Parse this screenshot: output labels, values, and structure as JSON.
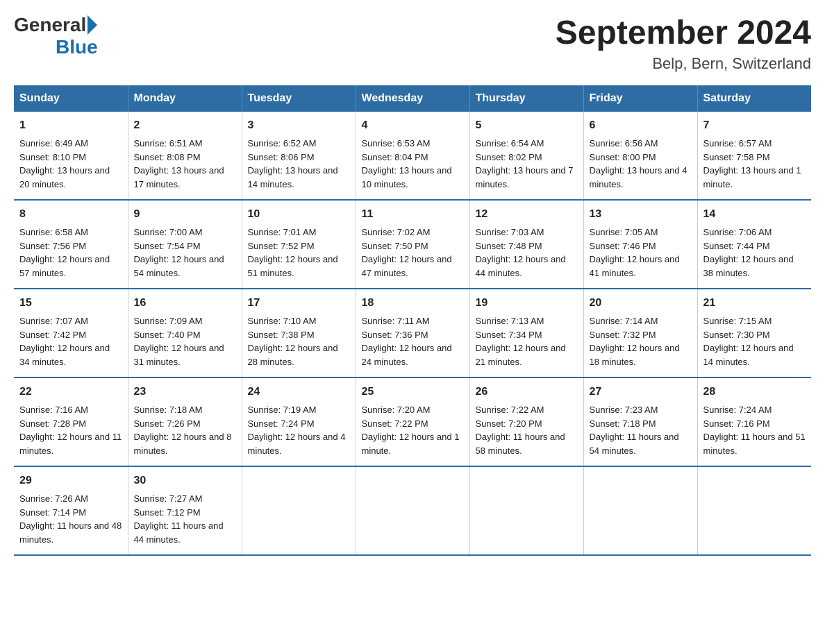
{
  "logo": {
    "general": "General",
    "blue": "Blue"
  },
  "title": "September 2024",
  "location": "Belp, Bern, Switzerland",
  "days_of_week": [
    "Sunday",
    "Monday",
    "Tuesday",
    "Wednesday",
    "Thursday",
    "Friday",
    "Saturday"
  ],
  "weeks": [
    [
      {
        "day": "1",
        "sunrise": "6:49 AM",
        "sunset": "8:10 PM",
        "daylight": "13 hours and 20 minutes."
      },
      {
        "day": "2",
        "sunrise": "6:51 AM",
        "sunset": "8:08 PM",
        "daylight": "13 hours and 17 minutes."
      },
      {
        "day": "3",
        "sunrise": "6:52 AM",
        "sunset": "8:06 PM",
        "daylight": "13 hours and 14 minutes."
      },
      {
        "day": "4",
        "sunrise": "6:53 AM",
        "sunset": "8:04 PM",
        "daylight": "13 hours and 10 minutes."
      },
      {
        "day": "5",
        "sunrise": "6:54 AM",
        "sunset": "8:02 PM",
        "daylight": "13 hours and 7 minutes."
      },
      {
        "day": "6",
        "sunrise": "6:56 AM",
        "sunset": "8:00 PM",
        "daylight": "13 hours and 4 minutes."
      },
      {
        "day": "7",
        "sunrise": "6:57 AM",
        "sunset": "7:58 PM",
        "daylight": "13 hours and 1 minute."
      }
    ],
    [
      {
        "day": "8",
        "sunrise": "6:58 AM",
        "sunset": "7:56 PM",
        "daylight": "12 hours and 57 minutes."
      },
      {
        "day": "9",
        "sunrise": "7:00 AM",
        "sunset": "7:54 PM",
        "daylight": "12 hours and 54 minutes."
      },
      {
        "day": "10",
        "sunrise": "7:01 AM",
        "sunset": "7:52 PM",
        "daylight": "12 hours and 51 minutes."
      },
      {
        "day": "11",
        "sunrise": "7:02 AM",
        "sunset": "7:50 PM",
        "daylight": "12 hours and 47 minutes."
      },
      {
        "day": "12",
        "sunrise": "7:03 AM",
        "sunset": "7:48 PM",
        "daylight": "12 hours and 44 minutes."
      },
      {
        "day": "13",
        "sunrise": "7:05 AM",
        "sunset": "7:46 PM",
        "daylight": "12 hours and 41 minutes."
      },
      {
        "day": "14",
        "sunrise": "7:06 AM",
        "sunset": "7:44 PM",
        "daylight": "12 hours and 38 minutes."
      }
    ],
    [
      {
        "day": "15",
        "sunrise": "7:07 AM",
        "sunset": "7:42 PM",
        "daylight": "12 hours and 34 minutes."
      },
      {
        "day": "16",
        "sunrise": "7:09 AM",
        "sunset": "7:40 PM",
        "daylight": "12 hours and 31 minutes."
      },
      {
        "day": "17",
        "sunrise": "7:10 AM",
        "sunset": "7:38 PM",
        "daylight": "12 hours and 28 minutes."
      },
      {
        "day": "18",
        "sunrise": "7:11 AM",
        "sunset": "7:36 PM",
        "daylight": "12 hours and 24 minutes."
      },
      {
        "day": "19",
        "sunrise": "7:13 AM",
        "sunset": "7:34 PM",
        "daylight": "12 hours and 21 minutes."
      },
      {
        "day": "20",
        "sunrise": "7:14 AM",
        "sunset": "7:32 PM",
        "daylight": "12 hours and 18 minutes."
      },
      {
        "day": "21",
        "sunrise": "7:15 AM",
        "sunset": "7:30 PM",
        "daylight": "12 hours and 14 minutes."
      }
    ],
    [
      {
        "day": "22",
        "sunrise": "7:16 AM",
        "sunset": "7:28 PM",
        "daylight": "12 hours and 11 minutes."
      },
      {
        "day": "23",
        "sunrise": "7:18 AM",
        "sunset": "7:26 PM",
        "daylight": "12 hours and 8 minutes."
      },
      {
        "day": "24",
        "sunrise": "7:19 AM",
        "sunset": "7:24 PM",
        "daylight": "12 hours and 4 minutes."
      },
      {
        "day": "25",
        "sunrise": "7:20 AM",
        "sunset": "7:22 PM",
        "daylight": "12 hours and 1 minute."
      },
      {
        "day": "26",
        "sunrise": "7:22 AM",
        "sunset": "7:20 PM",
        "daylight": "11 hours and 58 minutes."
      },
      {
        "day": "27",
        "sunrise": "7:23 AM",
        "sunset": "7:18 PM",
        "daylight": "11 hours and 54 minutes."
      },
      {
        "day": "28",
        "sunrise": "7:24 AM",
        "sunset": "7:16 PM",
        "daylight": "11 hours and 51 minutes."
      }
    ],
    [
      {
        "day": "29",
        "sunrise": "7:26 AM",
        "sunset": "7:14 PM",
        "daylight": "11 hours and 48 minutes."
      },
      {
        "day": "30",
        "sunrise": "7:27 AM",
        "sunset": "7:12 PM",
        "daylight": "11 hours and 44 minutes."
      },
      null,
      null,
      null,
      null,
      null
    ]
  ]
}
